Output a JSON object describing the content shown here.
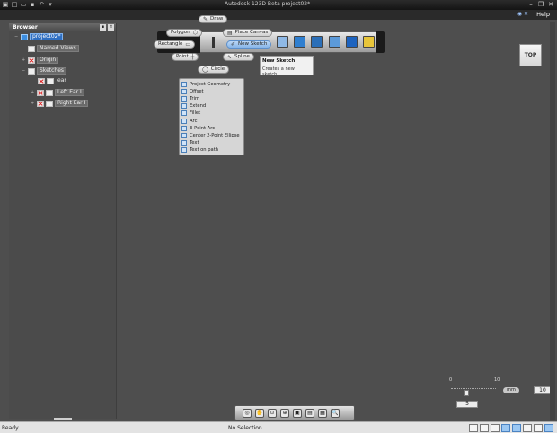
{
  "window": {
    "title": "Autodesk 123D Beta   project02*"
  },
  "help": {
    "label": "Help"
  },
  "browser": {
    "title": "Browser",
    "nodes": [
      {
        "label": "project02*"
      },
      {
        "label": "Named Views"
      },
      {
        "label": "Origin"
      },
      {
        "label": "Sketches"
      },
      {
        "label": "ear"
      },
      {
        "label": "Left Ear I"
      },
      {
        "label": "Right Ear I"
      }
    ]
  },
  "marking_menu": {
    "draw": "Draw",
    "polygon": "Polygon",
    "rectangle": "Rectangle",
    "point": "Point",
    "circle": "Circle",
    "place_canvas": "Place Canvas",
    "new_sketch": "New Sketch",
    "spline": "Spline"
  },
  "tooltip": {
    "title": "New Sketch",
    "body": "Creates a new sketch."
  },
  "sketch_menu": {
    "items": [
      "Project Geometry",
      "Offset",
      "Trim",
      "Extend",
      "Fillet",
      "Arc",
      "3-Point Arc",
      "Center 2-Point Ellipse",
      "Text",
      "Text on path"
    ]
  },
  "viewcube": {
    "face": "TOP"
  },
  "snap": {
    "scale_min": "0",
    "scale_max": "10",
    "value": "5",
    "unit": "mm",
    "grid": "10"
  },
  "status": {
    "left": "Ready",
    "center": "No Selection"
  },
  "colors": {
    "canvas": "#4e4e4e",
    "accent": "#3c8dde",
    "selection": "#2f6fc2"
  }
}
